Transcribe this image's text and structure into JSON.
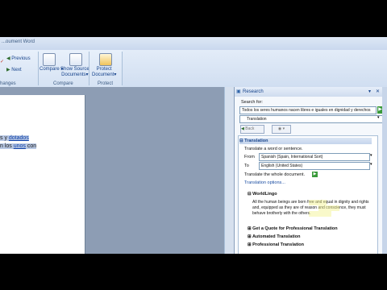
{
  "ribbon": {
    "title_fragment": "...oument Word",
    "previous_label": "Previous",
    "next_label": "Next",
    "changes_caption": "hanges",
    "compare_label": "Compare",
    "show_source_label": "Show Source",
    "documents_label": "Documents",
    "compare_caption": "Compare",
    "protect_label": "Protect",
    "document_label": "Document",
    "protect_caption": "Protect"
  },
  "document": {
    "line1_prefix": "s y ",
    "line1_link": "dotados",
    "line2_prefix": "n los ",
    "line2_link": "unos",
    "line2_suffix": " con"
  },
  "research": {
    "title": "Research",
    "search_label": "Search for:",
    "search_value": "Todos los seres humanos nacen libres e iguales en dignidad y derechos",
    "service_value": "Translation",
    "back_label": "Back",
    "translation_heading": "Translation",
    "translate_word_text": "Translate a word or sentence.",
    "from_label": "From",
    "from_value": "Spanish (Spain, International Sort)",
    "to_label": "To",
    "to_value": "English (United States)",
    "translate_doc_text": "Translate the whole document.",
    "options_link": "Translation options...",
    "worldlingo_heading": "WorldLingo",
    "result_text": "All the human beings are born free and equal in dignity and rights and, equipped as they are of reason and conscience, they must behave brotherly with the others.",
    "result_highlight_1": "free and equal",
    "result_highlight_2": "are of reason and",
    "result_highlight_3": "with the others.",
    "quote_heading": "Get a Quote for Professional Translation",
    "automated_heading": "Automated Translation",
    "professional_heading": "Professional Translation"
  }
}
